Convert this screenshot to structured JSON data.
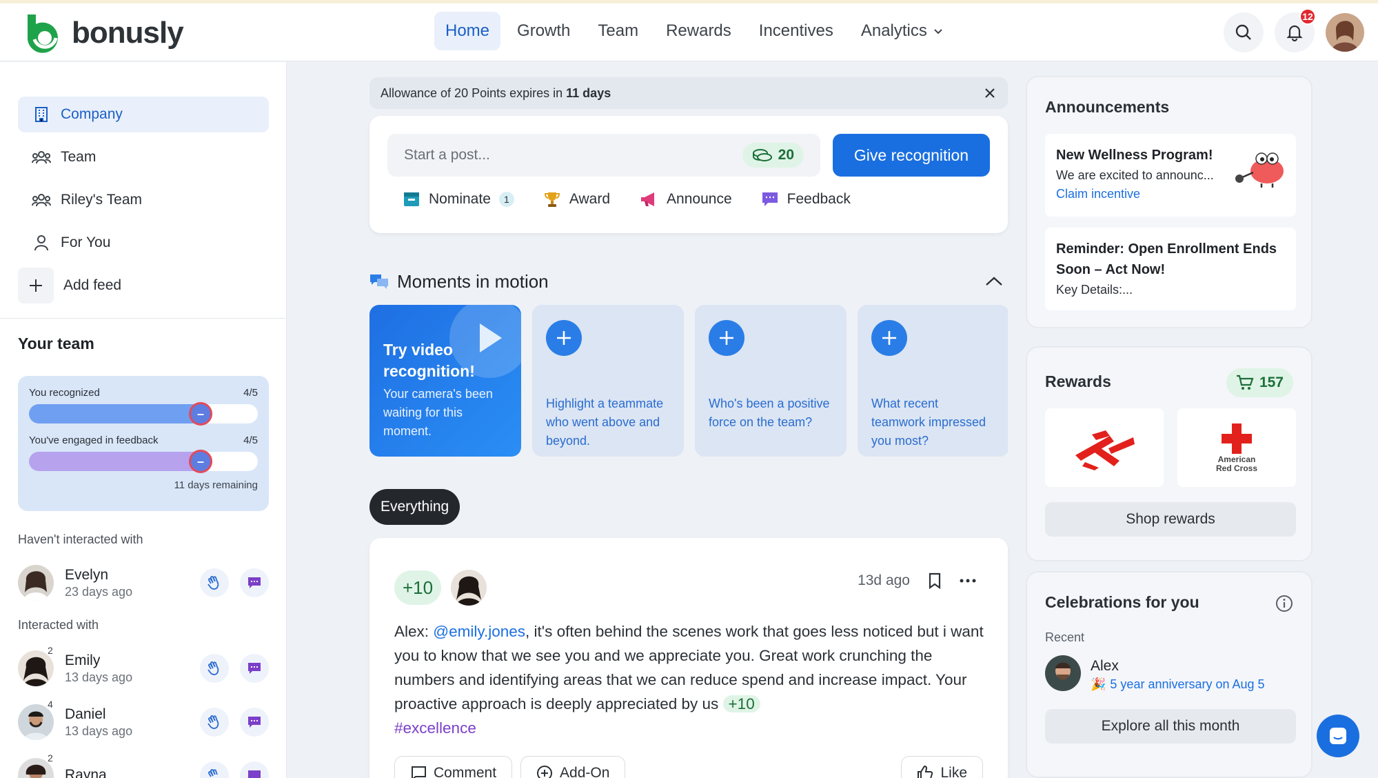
{
  "brand": {
    "name": "bonusly",
    "green": "#1fa34a",
    "blue": "#1a6fe0"
  },
  "nav": {
    "items": [
      "Home",
      "Growth",
      "Team",
      "Rewards",
      "Incentives",
      "Analytics"
    ],
    "active": "Home",
    "notifications_count": "12"
  },
  "sidebar": {
    "feeds": [
      {
        "label": "Company",
        "icon": "building-icon",
        "active": true
      },
      {
        "label": "Team",
        "icon": "team-icon"
      },
      {
        "label": "Riley's Team",
        "icon": "team-icon"
      },
      {
        "label": "For You",
        "icon": "person-icon"
      },
      {
        "label": "Add feed",
        "icon": "plus-icon"
      }
    ],
    "your_team_title": "Your team",
    "progress": {
      "recognized_label": "You recognized",
      "recognized_value": "4/5",
      "recognized_fraction": 0.8,
      "feedback_label": "You've engaged in feedback",
      "feedback_value": "4/5",
      "feedback_fraction": 0.8,
      "days_remaining": "11 days remaining"
    },
    "not_interacted_label": "Haven't interacted with",
    "interacted_label": "Interacted with",
    "not_interacted": [
      {
        "name": "Evelyn",
        "time": "23 days ago"
      }
    ],
    "interacted": [
      {
        "name": "Emily",
        "time": "13 days ago",
        "count": "2"
      },
      {
        "name": "Daniel",
        "time": "13 days ago",
        "count": "4"
      },
      {
        "name": "Rayna",
        "time": "",
        "count": "2"
      }
    ]
  },
  "allowance": {
    "prefix": "Allowance of 20 Points expires in ",
    "days": "11 days"
  },
  "composer": {
    "placeholder": "Start a post...",
    "points": "20",
    "give_label": "Give recognition",
    "actions": [
      {
        "label": "Nominate",
        "count": "1",
        "icon": "nominate-icon"
      },
      {
        "label": "Award",
        "icon": "trophy-icon"
      },
      {
        "label": "Announce",
        "icon": "megaphone-icon"
      },
      {
        "label": "Feedback",
        "icon": "feedback-icon"
      }
    ]
  },
  "moments": {
    "title": "Moments in motion",
    "primary_title": "Try video recognition!",
    "primary_sub": "Your camera's been waiting for this moment.",
    "prompts": [
      "Highlight a teammate who went above and beyond.",
      "Who's been a positive force on the team?",
      "What recent teamwork impressed you most?"
    ]
  },
  "filter": {
    "label": "Everything"
  },
  "post": {
    "points": "+10",
    "time": "13d ago",
    "author": "Alex:",
    "mention": "@emily.jones",
    "body": ", it's often behind the scenes work that goes less noticed but i want you to know that we see you and we appreciate you. Great work crunching the numbers and identifying areas that we can reduce spend and increase impact. Your proactive approach is deeply appreciated by us ",
    "inline_points": "+10",
    "hashtag": "#excellence",
    "comment_label": "Comment",
    "addon_label": "Add-On",
    "like_label": "Like"
  },
  "announcements": {
    "title": "Announcements",
    "items": [
      {
        "title": "New Wellness Program!",
        "text": "We are excited to announc...",
        "link": "Claim incentive"
      },
      {
        "title": "Reminder: Open Enrollment Ends Soon – Act Now!",
        "text": "Key Details:..."
      }
    ]
  },
  "rewards": {
    "title": "Rewards",
    "points": "157",
    "tile2_line1": "American",
    "tile2_line2": "Red Cross",
    "shop_label": "Shop rewards"
  },
  "celebrations": {
    "title": "Celebrations for you",
    "recent_label": "Recent",
    "name": "Alex",
    "event": "5 year anniversary on Aug 5",
    "explore_label": "Explore all this month"
  }
}
